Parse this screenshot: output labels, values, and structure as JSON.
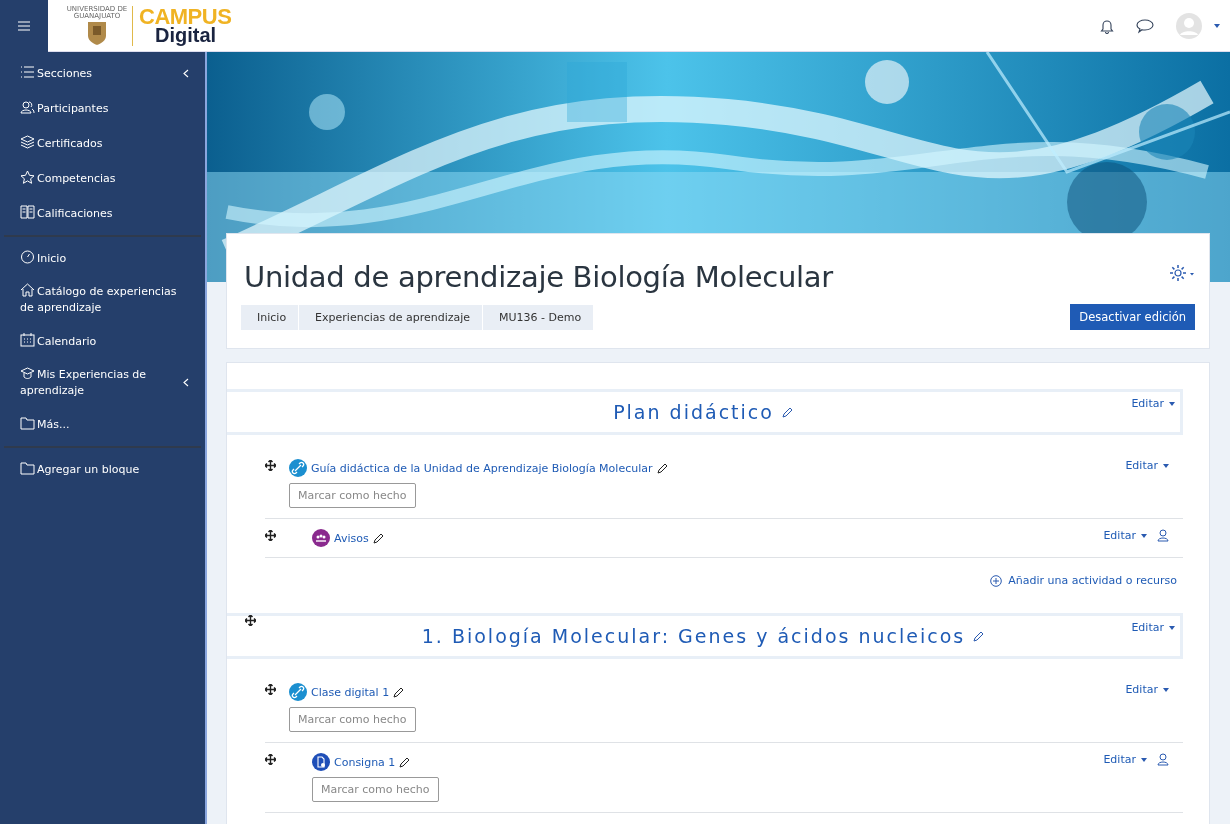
{
  "header": {
    "logo": {
      "university": "UNIVERSIDAD DE GUANAJUATO",
      "line_1": "CAMPUS",
      "line_2": "Digital"
    }
  },
  "sidebar": {
    "groups": [
      [
        {
          "label": "Secciones",
          "kind": "list",
          "expandable": true
        },
        {
          "label": "Participantes",
          "kind": "people",
          "expandable": false
        },
        {
          "label": "Certificados",
          "kind": "layers",
          "expandable": false
        },
        {
          "label": "Competencias",
          "kind": "star",
          "expandable": false
        },
        {
          "label": "Calificaciones",
          "kind": "book",
          "expandable": false
        }
      ],
      [
        {
          "label": "Inicio",
          "kind": "gauge",
          "expandable": false
        },
        {
          "label": "Catálogo de experiencias de aprendizaje",
          "kind": "home",
          "expandable": false
        },
        {
          "label": "Calendario",
          "kind": "calendar",
          "expandable": false
        },
        {
          "label": "Mis Experiencias de aprendizaje",
          "kind": "cap",
          "expandable": true
        },
        {
          "label": "Más...",
          "kind": "folder",
          "expandable": false
        }
      ],
      [
        {
          "label": "Agregar un bloque",
          "kind": "folder",
          "expandable": false
        }
      ]
    ]
  },
  "course": {
    "title": "Unidad de aprendizaje Biología Molecular",
    "breadcrumb": [
      "Inicio",
      "Experiencias de aprendizaje",
      "MU136 - Demo"
    ],
    "edit_button": "Desactivar edición"
  },
  "sections": [
    {
      "title": "Plan didáctico",
      "movable": false,
      "edit_menu": "Editar",
      "add_link": "Añadir una actividad o recurso",
      "activities": [
        {
          "kind": "url",
          "name": "Guía didáctica de la Unidad de Aprendizaje Biología Molecular",
          "indented": false,
          "edit_menu": "Editar",
          "person_icon": false,
          "completion_button": "Marcar como hecho"
        },
        {
          "kind": "forum",
          "name": "Avisos",
          "indented": true,
          "edit_menu": "Editar",
          "person_icon": true
        }
      ]
    },
    {
      "title": "1. Biología Molecular: Genes y ácidos nucleicos",
      "movable": true,
      "edit_menu": "Editar",
      "activities": [
        {
          "kind": "url",
          "name": "Clase digital 1",
          "indented": false,
          "edit_menu": "Editar",
          "person_icon": false,
          "completion_button": "Marcar como hecho"
        },
        {
          "kind": "assign",
          "name": "Consigna 1",
          "indented": true,
          "edit_menu": "Editar",
          "person_icon": true,
          "completion_button": "Marcar como hecho"
        }
      ]
    }
  ]
}
